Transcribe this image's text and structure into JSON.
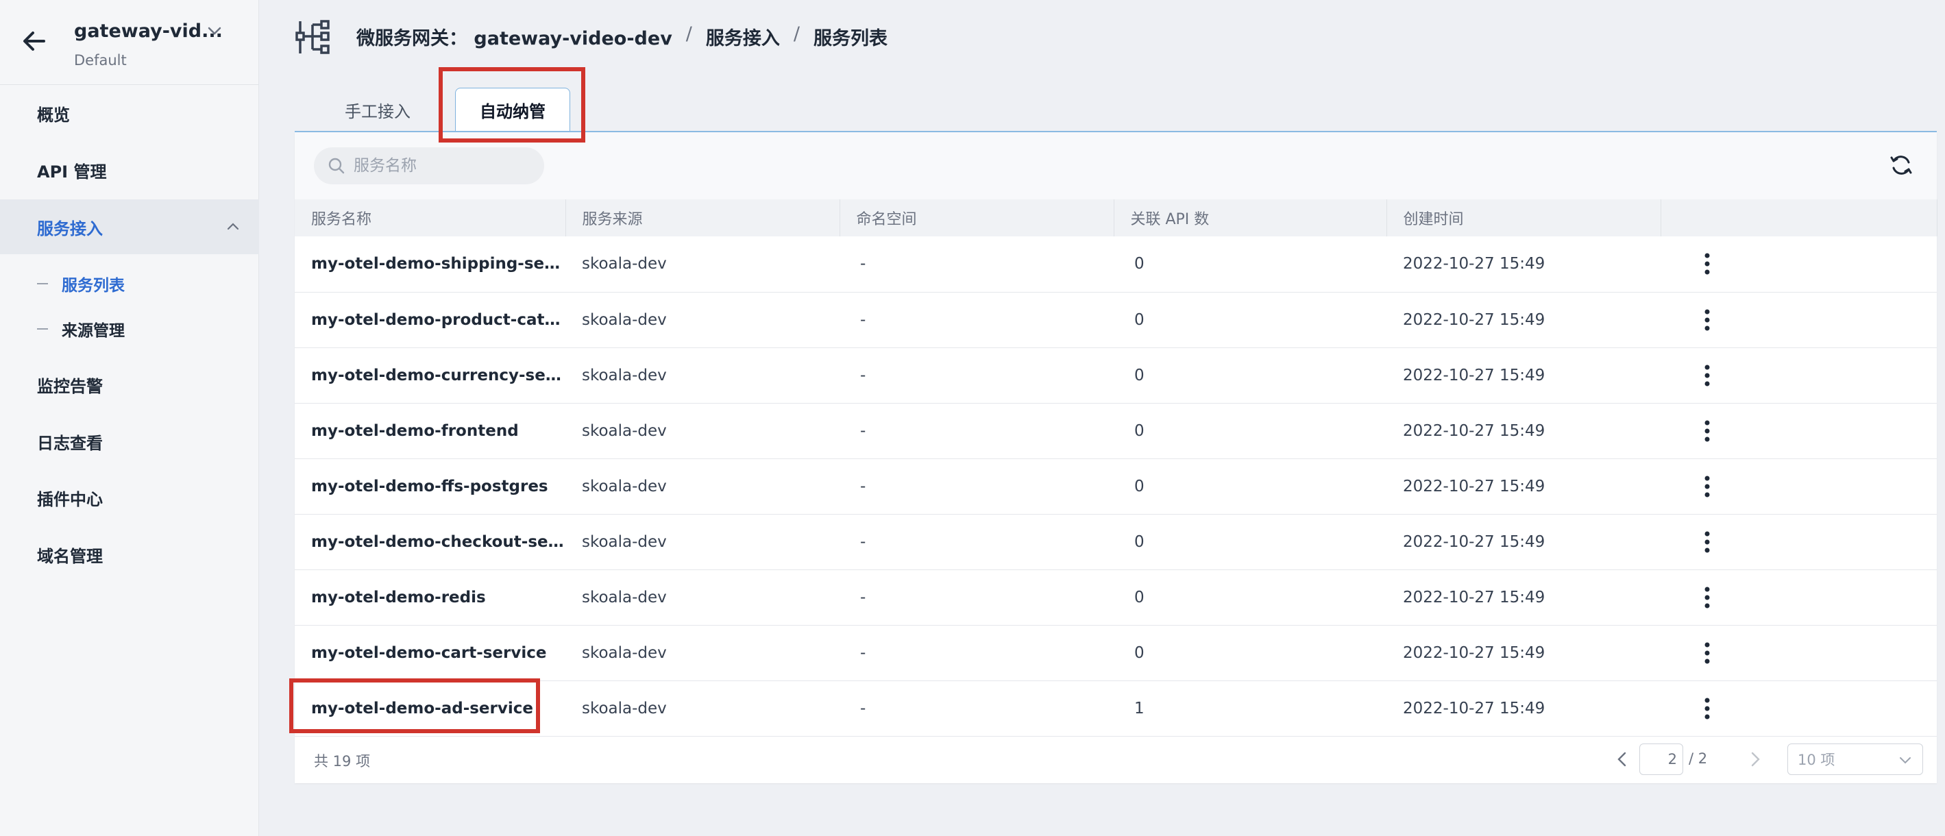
{
  "gateway": {
    "name": "gateway-vid...",
    "workspace": "Default"
  },
  "sidebar": {
    "items": [
      {
        "label": "概览"
      },
      {
        "label": "API 管理"
      },
      {
        "label": "服务接入"
      },
      {
        "label": "监控告警"
      },
      {
        "label": "日志查看"
      },
      {
        "label": "插件中心"
      },
      {
        "label": "域名管理"
      }
    ],
    "sub_items": [
      {
        "label": "服务列表"
      },
      {
        "label": "来源管理"
      }
    ]
  },
  "breadcrumb": {
    "root": "微服务网关：  gateway-video-dev",
    "sep": "/",
    "level1": "服务接入",
    "level2": "服务列表"
  },
  "tabs": [
    {
      "label": "手工接入"
    },
    {
      "label": "自动纳管"
    }
  ],
  "search": {
    "placeholder": "服务名称"
  },
  "table": {
    "columns": [
      "服务名称",
      "服务来源",
      "命名空间",
      "关联 API 数",
      "创建时间",
      ""
    ],
    "rows": [
      {
        "name": "my-otel-demo-shipping-service",
        "source": "skoala-dev",
        "namespace": "-",
        "api_count": "0",
        "created": "2022-10-27 15:49"
      },
      {
        "name": "my-otel-demo-product-catalo...",
        "source": "skoala-dev",
        "namespace": "-",
        "api_count": "0",
        "created": "2022-10-27 15:49"
      },
      {
        "name": "my-otel-demo-currency-service",
        "source": "skoala-dev",
        "namespace": "-",
        "api_count": "0",
        "created": "2022-10-27 15:49"
      },
      {
        "name": "my-otel-demo-frontend",
        "source": "skoala-dev",
        "namespace": "-",
        "api_count": "0",
        "created": "2022-10-27 15:49"
      },
      {
        "name": "my-otel-demo-ffs-postgres",
        "source": "skoala-dev",
        "namespace": "-",
        "api_count": "0",
        "created": "2022-10-27 15:49"
      },
      {
        "name": "my-otel-demo-checkout-service",
        "source": "skoala-dev",
        "namespace": "-",
        "api_count": "0",
        "created": "2022-10-27 15:49"
      },
      {
        "name": "my-otel-demo-redis",
        "source": "skoala-dev",
        "namespace": "-",
        "api_count": "0",
        "created": "2022-10-27 15:49"
      },
      {
        "name": "my-otel-demo-cart-service",
        "source": "skoala-dev",
        "namespace": "-",
        "api_count": "0",
        "created": "2022-10-27 15:49"
      },
      {
        "name": "my-otel-demo-ad-service",
        "source": "skoala-dev",
        "namespace": "-",
        "api_count": "1",
        "created": "2022-10-27 15:49"
      }
    ]
  },
  "pagination": {
    "total_label": "共 19 项",
    "current_page": "2",
    "total_pages": "/ 2",
    "page_size": "10 项"
  },
  "colors": {
    "accent": "#2e6bd1",
    "highlight": "#d0342c",
    "tab_border": "#8bbbe3"
  }
}
